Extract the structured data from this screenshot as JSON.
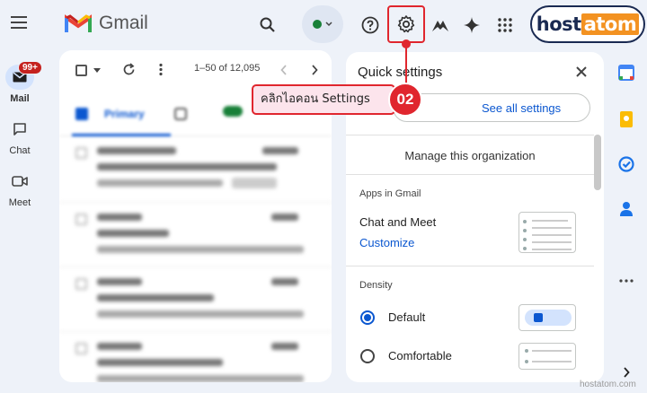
{
  "header": {
    "app_name": "Gmail",
    "brand": {
      "part1": "host",
      "part2": "atom"
    }
  },
  "rail": {
    "mail_badge": "99+",
    "items": [
      {
        "label": "Mail"
      },
      {
        "label": "Chat"
      },
      {
        "label": "Meet"
      }
    ]
  },
  "mail_list": {
    "range": "1–50 of 12,095",
    "tabs": [
      "Primary"
    ]
  },
  "quick_settings": {
    "title": "Quick settings",
    "see_all": "See all settings",
    "manage_org": "Manage this organization",
    "apps_heading": "Apps in Gmail",
    "chat_meet": "Chat and Meet",
    "customize": "Customize",
    "density_heading": "Density",
    "density_options": [
      "Default",
      "Comfortable"
    ],
    "density_selected": "Default"
  },
  "annotation": {
    "text": "คลิกไอคอน Settings",
    "step": "02"
  },
  "watermark": "hostatom.com",
  "colors": {
    "accent_blue": "#0b57d0",
    "annotation_red": "#e0262e",
    "brand_orange": "#f39221",
    "brand_navy": "#1a2a52"
  }
}
